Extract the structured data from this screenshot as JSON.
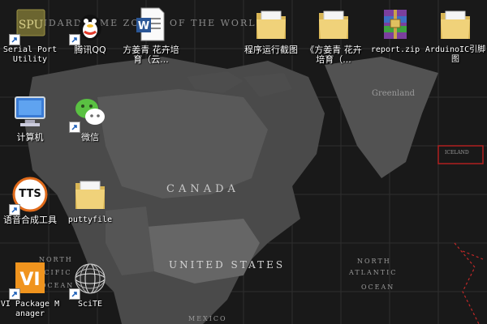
{
  "wallpaper": {
    "title": "STANDARD TIME ZONES OF THE WORLD",
    "labels": {
      "canada": "CANADA",
      "united_states": "UNITED STATES",
      "greenland": "Greenland",
      "north": "NORTH",
      "atlantic": "ATLANTIC",
      "ocean": "OCEAN",
      "mexico": "MEXICO",
      "north_left": "NORTH",
      "pacific": "PACIFIC",
      "ocean_left": "OCEAN",
      "iceland": "ICELAND"
    }
  },
  "desktop": {
    "icons": [
      {
        "label": "Serial Port Utility",
        "icon": "serial-port-utility-icon"
      },
      {
        "label": "腾讯QQ",
        "icon": "qq-penguin-icon"
      },
      {
        "label": "方姜青 花卉培育（云...",
        "icon": "word-document-icon"
      },
      {
        "label": "程序运行截图",
        "icon": "folder-icon"
      },
      {
        "label": "《方姜青 花卉培育（...",
        "icon": "folder-icon"
      },
      {
        "label": "report.zip",
        "icon": "winrar-archive-icon"
      },
      {
        "label": "ArduinoIC引脚图",
        "icon": "folder-icon"
      },
      {
        "label": "计算机",
        "icon": "computer-icon"
      },
      {
        "label": "微信",
        "icon": "wechat-icon"
      },
      {
        "label": "语音合成工具",
        "icon": "tts-icon"
      },
      {
        "label": "puttyfile",
        "icon": "folder-icon"
      },
      {
        "label": "VI Package Manager",
        "icon": "vi-package-manager-icon"
      },
      {
        "label": "SciTE",
        "icon": "scite-icon"
      }
    ]
  },
  "colors": {
    "folder": "#e8c76a",
    "wechat": "#5ac142",
    "vipm": "#f0941e",
    "winrar": "#7b3f9e",
    "word": "#2b5797"
  }
}
